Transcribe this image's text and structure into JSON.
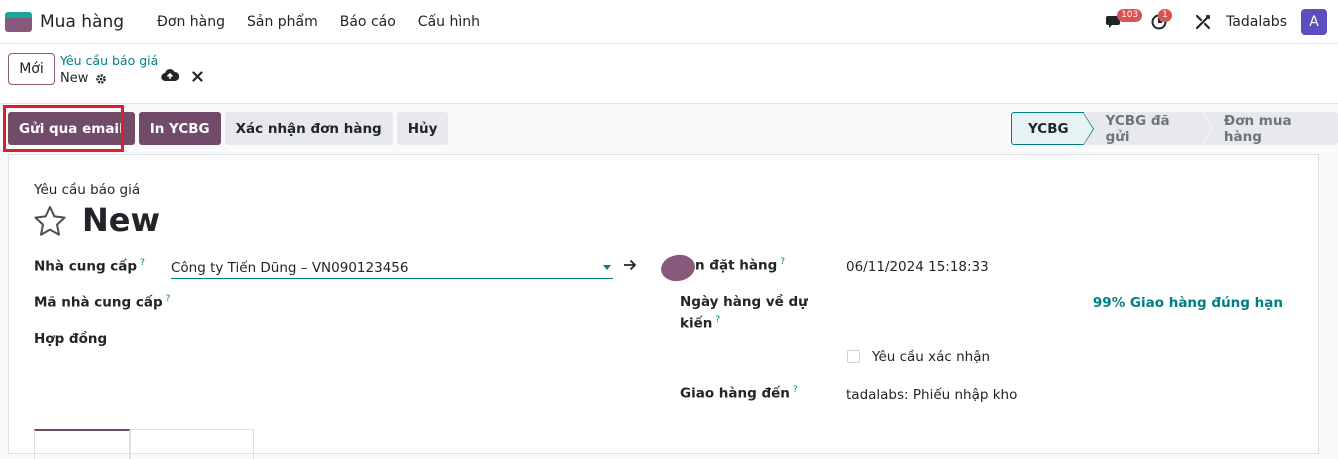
{
  "app": {
    "name": "Mua hàng"
  },
  "menu": [
    "Đơn hàng",
    "Sản phẩm",
    "Báo cáo",
    "Cấu hình"
  ],
  "systray": {
    "messages_count": "103",
    "activity_count": "1",
    "company": "Tadalabs",
    "avatar_letter": "A"
  },
  "control": {
    "new_label": "Mới",
    "breadcrumb_parent": "Yêu cầu báo giá",
    "breadcrumb_current": "New"
  },
  "actions": {
    "send_email": "Gửi qua email",
    "print_rfq": "In YCBG",
    "confirm_order": "Xác nhận đơn hàng",
    "cancel": "Hủy"
  },
  "status": {
    "stages": [
      "YCBG",
      "YCBG đã gửi",
      "Đơn mua hàng"
    ],
    "active_index": 0
  },
  "form": {
    "doc_type": "Yêu cầu báo giá",
    "title": "New",
    "vendor_label": "Nhà cung cấp",
    "vendor_value": "Công ty Tiến Dũng – VN090123456",
    "vendor_ref_label": "Mã nhà cung cấp",
    "contract_label": "Hợp đồng",
    "order_deadline_label": "n đặt hàng",
    "order_deadline_value": "06/11/2024 15:18:33",
    "expected_arrival_label_1": "Ngày hàng về dự",
    "expected_arrival_label_2": "kiến",
    "ontime_rate": "99% Giao hàng đúng hạn",
    "ask_confirmation_label": "Yêu cầu xác nhận",
    "deliver_to_label": "Giao hàng đến",
    "deliver_to_value": "tadalabs: Phiếu nhập kho",
    "help_mark": "?"
  },
  "colors": {
    "brand": "#714b67",
    "accent": "#017e84",
    "highlight": "#e01e2b"
  }
}
